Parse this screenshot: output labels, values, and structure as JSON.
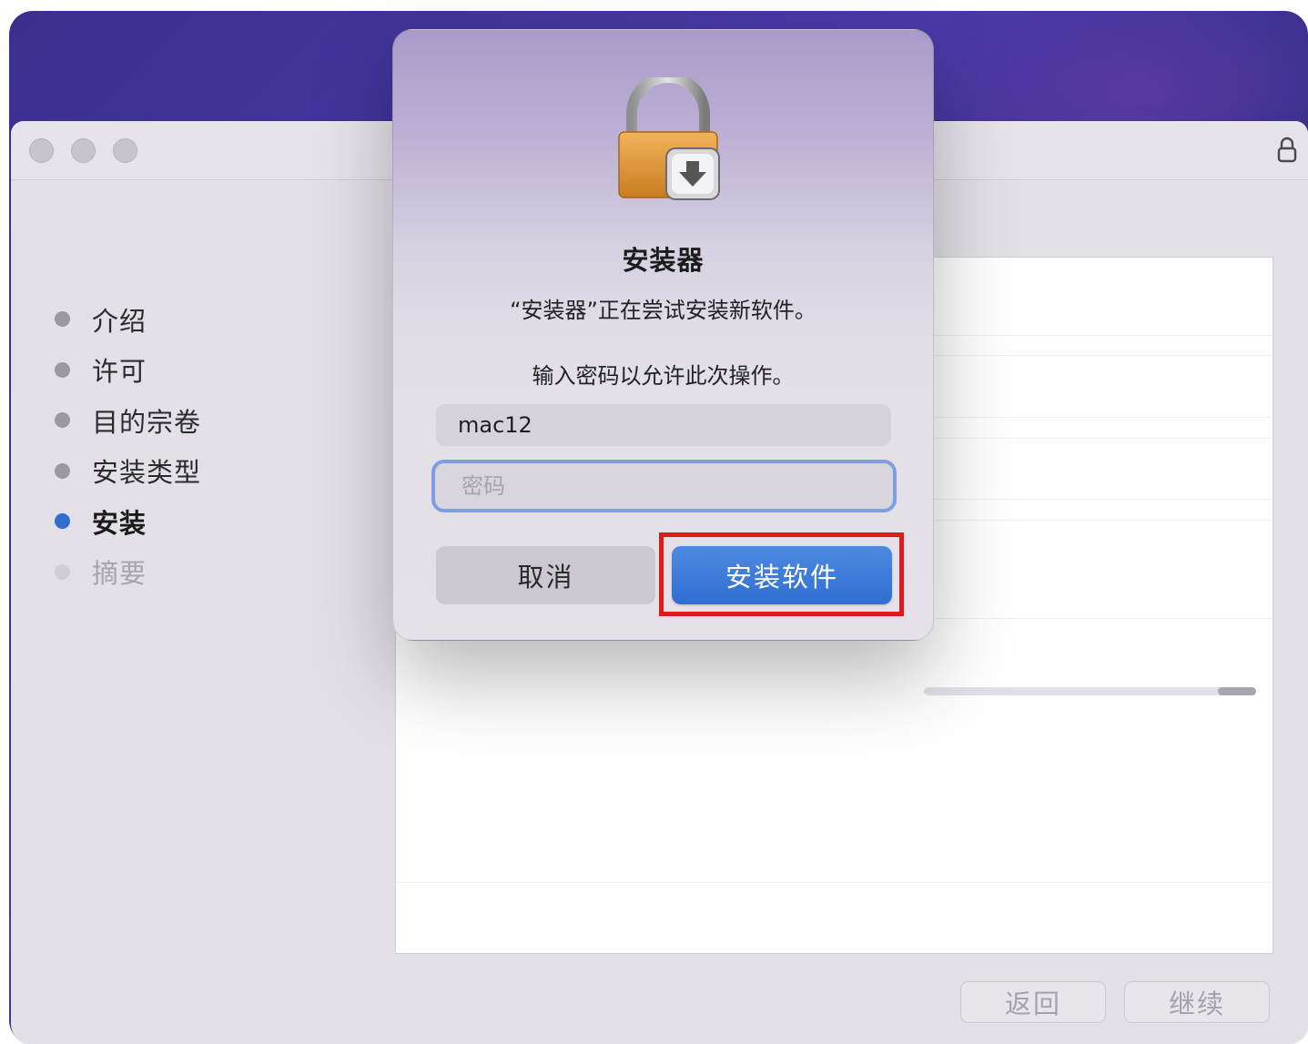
{
  "dialog": {
    "title": "安装器",
    "message": "“安装器”正在尝试安装新软件。",
    "info": "输入密码以允许此次操作。",
    "username_value": "mac12",
    "password_placeholder": "密码",
    "cancel_label": "取消",
    "install_label": "安装软件",
    "icon": "lock-installer-icon"
  },
  "sidebar": {
    "steps": [
      {
        "label": "介绍",
        "state": "done"
      },
      {
        "label": "许可",
        "state": "done"
      },
      {
        "label": "目的宗卷",
        "state": "done"
      },
      {
        "label": "安装类型",
        "state": "done"
      },
      {
        "label": "安装",
        "state": "active"
      },
      {
        "label": "摘要",
        "state": "future"
      }
    ]
  },
  "footer": {
    "back_label": "返回",
    "continue_label": "继续"
  },
  "titlebar": {
    "lock_icon": "lock-icon"
  },
  "colors": {
    "accent": "#2f6fd0",
    "highlight": "#e01a1a",
    "wallpaper": "#3b2f8f"
  }
}
